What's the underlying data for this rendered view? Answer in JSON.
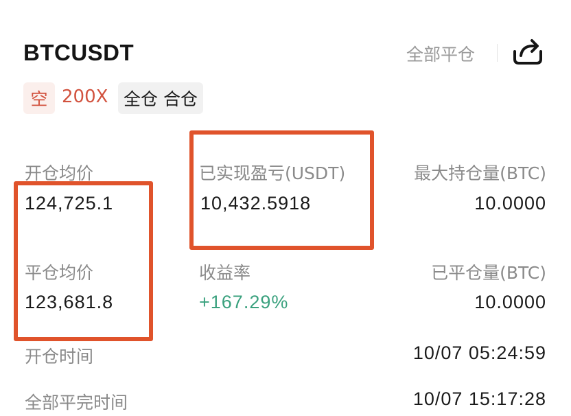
{
  "header": {
    "symbol": "BTCUSDT",
    "close_all_label": "全部平仓",
    "share_icon": "share-arrow-icon"
  },
  "tags": {
    "side": "空",
    "leverage": "200X",
    "margin_mode": "全仓 合仓"
  },
  "stats": {
    "open_avg_price": {
      "label": "开仓均价",
      "value": "124,725.1"
    },
    "realized_pnl": {
      "label": "已实现盈亏(USDT)",
      "value": "10,432.5918"
    },
    "max_position": {
      "label": "最大持仓量(BTC)",
      "value": "10.0000"
    },
    "close_avg_price": {
      "label": "平仓均价",
      "value": "123,681.8"
    },
    "roi": {
      "label": "收益率",
      "value": "+167.29%"
    },
    "closed_position": {
      "label": "已平仓量(BTC)",
      "value": "10.0000"
    },
    "open_time": {
      "label": "开仓时间",
      "value": "10/07 05:24:59"
    },
    "full_close_time": {
      "label": "全部平完时间",
      "value": "10/07 15:17:28"
    }
  },
  "colors": {
    "short": "#d2533f",
    "profit": "#3aa17e",
    "highlight": "#e0532b",
    "muted": "#8a8a8a"
  }
}
